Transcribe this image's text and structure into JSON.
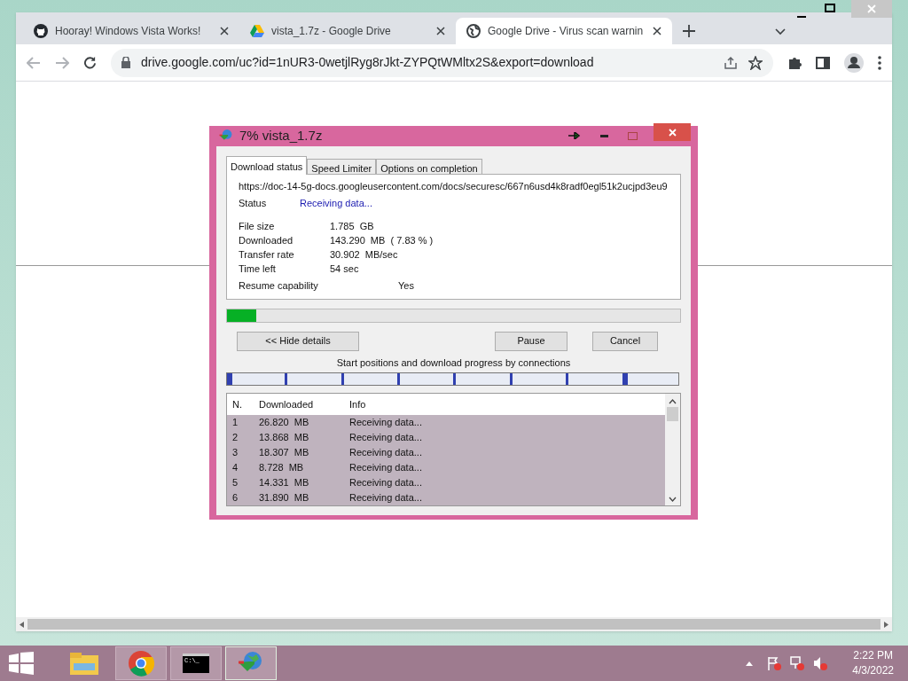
{
  "browser": {
    "tabs": [
      {
        "title": "Hooray! Windows Vista Works!",
        "selected": false
      },
      {
        "title": "vista_1.7z - Google Drive",
        "selected": false
      },
      {
        "title": "Google Drive - Virus scan warnin",
        "selected": true
      }
    ],
    "address": "drive.google.com/uc?id=1nUR3-0wetjlRyg8rJkt-ZYPQtWMltx2S&export=download"
  },
  "dialog": {
    "title": "7% vista_1.7z",
    "tabs": [
      {
        "label": "Download status",
        "selected": true
      },
      {
        "label": "Speed Limiter",
        "selected": false
      },
      {
        "label": "Options on completion",
        "selected": false
      }
    ],
    "url": "https://doc-14-5g-docs.googleusercontent.com/docs/securesc/667n6usd4k8radf0egl51k2ucjpd3eu9",
    "status_label": "Status",
    "status_value": "Receiving data...",
    "fields": [
      {
        "label": "File size",
        "value": "1.785  GB"
      },
      {
        "label": "Downloaded",
        "value": "143.290  MB  ( 7.83 % )"
      },
      {
        "label": "Transfer rate",
        "value": "30.902  MB/sec"
      },
      {
        "label": "Time left",
        "value": "54 sec"
      }
    ],
    "resume_label": "Resume capability",
    "resume_value": "Yes",
    "progress": {
      "level": 0.065
    },
    "buttons": {
      "hide": "<< Hide details",
      "pause": "Pause",
      "cancel": "Cancel"
    },
    "connections_caption": "Start positions and download progress by connections",
    "table": {
      "columns": [
        "N.",
        "Downloaded",
        "Info"
      ],
      "rows": [
        {
          "cells": [
            "1",
            "26.820  MB",
            "Receiving data..."
          ],
          "selected": true
        },
        {
          "cells": [
            "2",
            "13.868  MB",
            "Receiving data..."
          ],
          "selected": true
        },
        {
          "cells": [
            "3",
            "18.307  MB",
            "Receiving data..."
          ],
          "selected": true
        },
        {
          "cells": [
            "4",
            "8.728  MB",
            "Receiving data..."
          ],
          "selected": true
        },
        {
          "cells": [
            "5",
            "14.331  MB",
            "Receiving data..."
          ],
          "selected": true
        },
        {
          "cells": [
            "6",
            "31.890  MB",
            "Receiving data..."
          ],
          "selected": true
        }
      ]
    }
  },
  "taskbar": {
    "cmd_text": "C:\\_",
    "time": "2:22 PM",
    "date": "4/3/2022"
  }
}
